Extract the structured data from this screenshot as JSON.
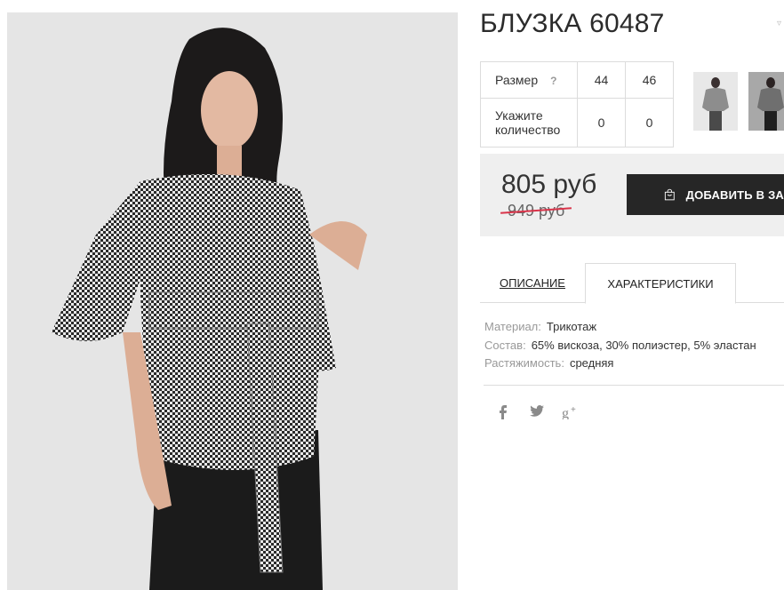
{
  "product": {
    "title": "БЛУЗКА 60487"
  },
  "sizes": {
    "size_label": "Размер",
    "help": "?",
    "options": [
      "44",
      "46"
    ],
    "qty_label": "Укажите количество",
    "quantities": [
      "0",
      "0"
    ]
  },
  "pricing": {
    "price": "805 руб",
    "old_price": "949 руб",
    "add_to_cart": "ДОБАВИТЬ В ЗА"
  },
  "tabs": {
    "description": "ОПИСАНИЕ",
    "characteristics": "ХАРАКТЕРИСТИКИ"
  },
  "specs": [
    {
      "key": "Материал:",
      "value": "Трикотаж"
    },
    {
      "key": "Состав:",
      "value": "65% вискоза, 30% полиэстер, 5% эластан"
    },
    {
      "key": "Растяжимость:",
      "value": "средняя"
    }
  ],
  "social": {
    "facebook": "f",
    "twitter": "t",
    "google_plus": "g+"
  },
  "colors": {
    "accent_strike": "#d9344a",
    "button_bg": "#262626",
    "price_box_bg": "#efefef"
  }
}
